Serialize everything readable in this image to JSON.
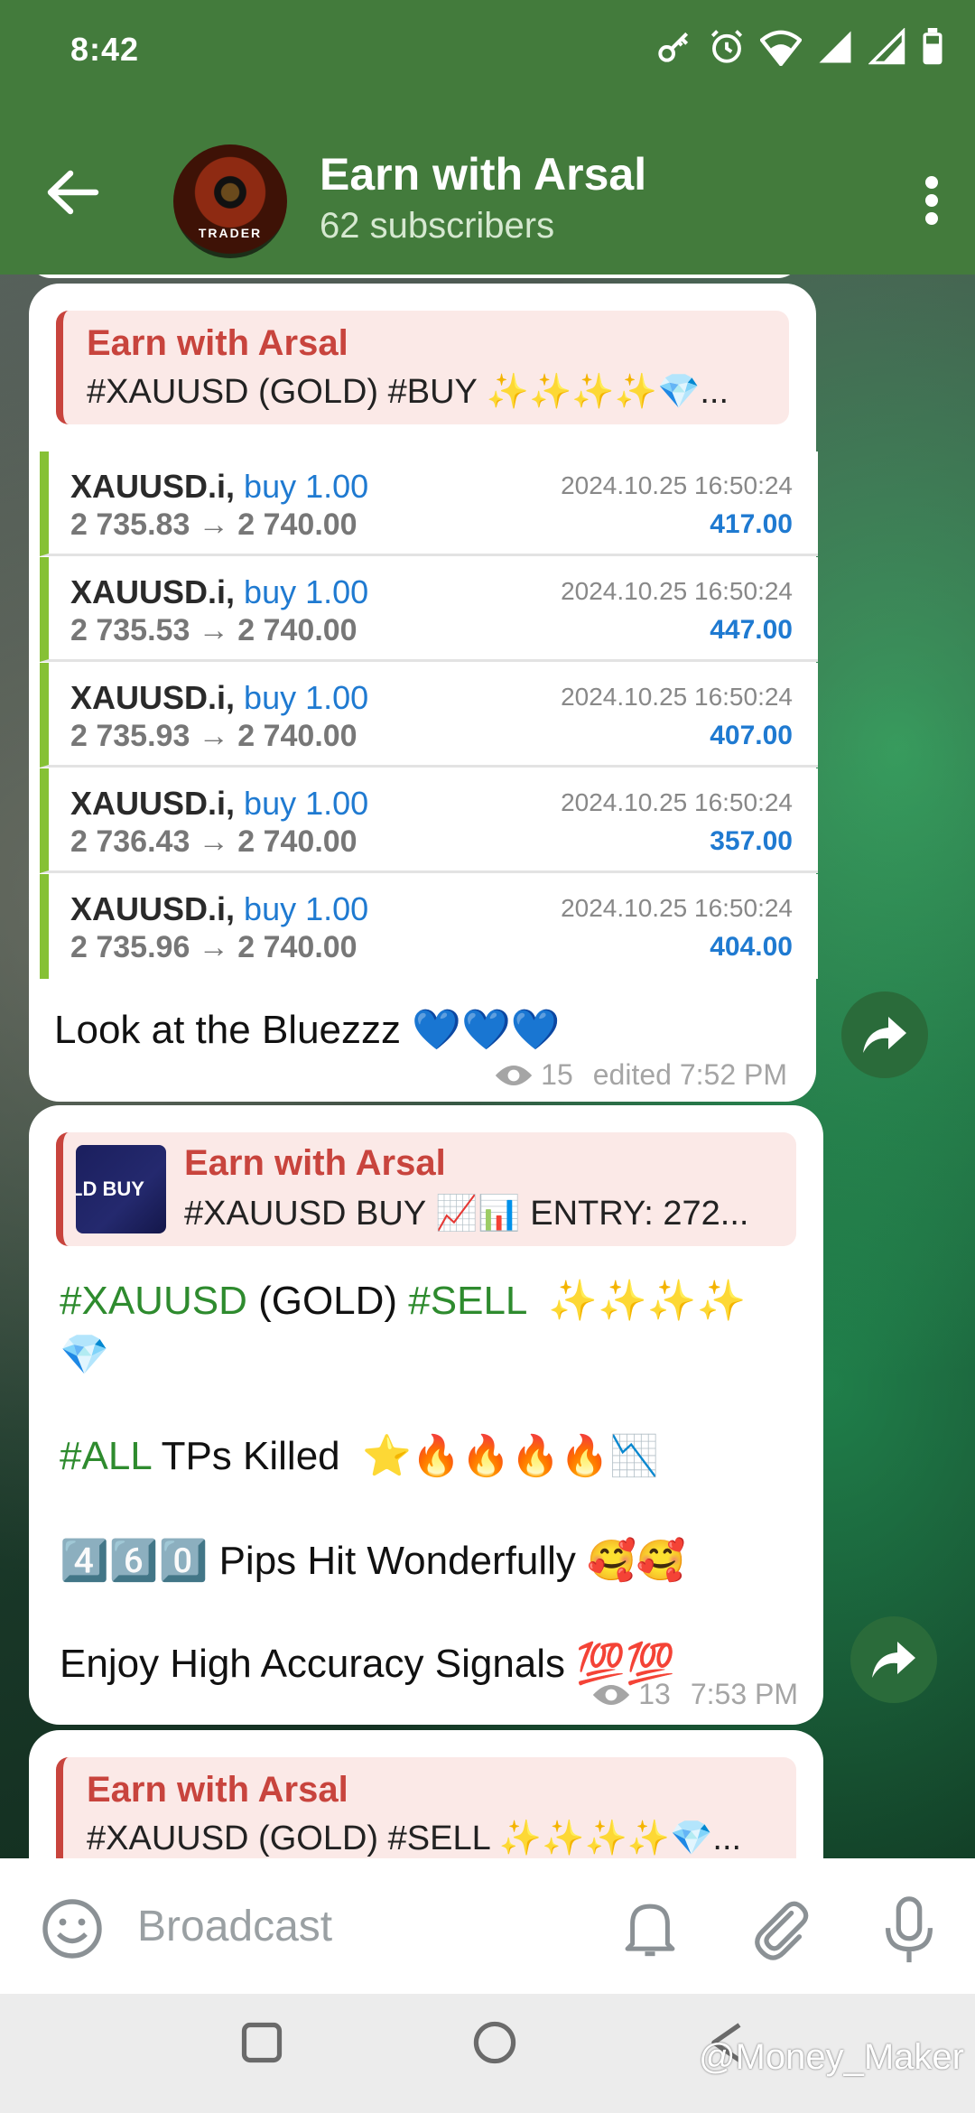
{
  "status_bar": {
    "time": "8:42"
  },
  "header": {
    "title": "Earn with Arsal",
    "subtitle": "62 subscribers",
    "avatar_text": "TRADER"
  },
  "messages": [
    {
      "quote_name": "Earn with Arsal",
      "quote_text": "#XAUUSD (GOLD) #BUY   ✨✨✨✨💎...",
      "trades": [
        {
          "symbol": "XAUUSD.i,",
          "side": "buy 1.00",
          "prices": "2 735.83 → 2 740.00",
          "datetime": "2024.10.25 16:50:24",
          "profit": "417.00"
        },
        {
          "symbol": "XAUUSD.i,",
          "side": "buy 1.00",
          "prices": "2 735.53 → 2 740.00",
          "datetime": "2024.10.25 16:50:24",
          "profit": "447.00"
        },
        {
          "symbol": "XAUUSD.i,",
          "side": "buy 1.00",
          "prices": "2 735.93 → 2 740.00",
          "datetime": "2024.10.25 16:50:24",
          "profit": "407.00"
        },
        {
          "symbol": "XAUUSD.i,",
          "side": "buy 1.00",
          "prices": "2 736.43 → 2 740.00",
          "datetime": "2024.10.25 16:50:24",
          "profit": "357.00"
        },
        {
          "symbol": "XAUUSD.i,",
          "side": "buy 1.00",
          "prices": "2 735.96 → 2 740.00",
          "datetime": "2024.10.25 16:50:24",
          "profit": "404.00"
        }
      ],
      "text": "Look at the Bluezzz 💙💙💙",
      "views": "15",
      "time": "edited 7:52 PM"
    },
    {
      "quote_name": "Earn with Arsal",
      "quote_thumb_text": "LD BUY",
      "quote_text": "#XAUUSD  BUY 📈📊 ENTRY:  272...",
      "line1_tag1": "#XAUUSD",
      "line1_mid": " (GOLD) ",
      "line1_tag2": "#SELL",
      "line1_end": "  ✨✨✨✨",
      "line2": "💎",
      "line3_tag": "#ALL",
      "line3_text": " TPs Killed  ⭐🔥🔥🔥🔥📉",
      "line4": "4️⃣6️⃣0️⃣ Pips Hit Wonderfully 🥰🥰",
      "line5": "Enjoy High Accuracy Signals 💯💯",
      "views": "13",
      "time": "7:53 PM"
    },
    {
      "quote_name": "Earn with Arsal",
      "quote_text": "#XAUUSD (GOLD) #SELL  ✨✨✨✨💎..."
    }
  ],
  "input": {
    "placeholder": "Broadcast"
  },
  "watermark": "@Money_Maker",
  "colors": {
    "app_bar": "#437b3c",
    "tag_green": "#2e8b2e",
    "quote_red": "#c8443d",
    "buy_blue": "#1f7ad1"
  }
}
